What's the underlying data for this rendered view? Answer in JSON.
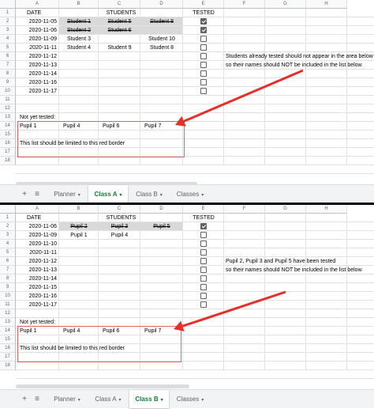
{
  "columns": [
    "A",
    "B",
    "C",
    "D",
    "E",
    "F",
    "G",
    "H"
  ],
  "rows": [
    "1",
    "2",
    "3",
    "4",
    "5",
    "6",
    "7",
    "8",
    "9",
    "10",
    "11",
    "12",
    "13",
    "14",
    "15",
    "16",
    "17",
    "18"
  ],
  "colors": {
    "tab_active": "#188038",
    "red_border": "#e06666",
    "arrow": "#e8302a",
    "cell_grey": "#d9d9d9"
  },
  "top": {
    "headers": {
      "date": "DATE",
      "students": "STUDENTS",
      "tested": "TESTED"
    },
    "records": [
      {
        "date": "2020-11-05",
        "b": "Student 1",
        "c": "Student 5",
        "d": "Student 8",
        "tested": true,
        "strike": true
      },
      {
        "date": "2020-11-06",
        "b": "Student 2",
        "c": "Student 6",
        "d": "",
        "tested": true,
        "strike": true
      },
      {
        "date": "2020-11-09",
        "b": "Student 3",
        "c": "",
        "d": "Student 10",
        "tested": false,
        "strike": false
      },
      {
        "date": "2020-11-11",
        "b": "Student 4",
        "c": "Student 9",
        "d": "Student 8",
        "tested": false,
        "strike": false
      },
      {
        "date": "2020-11-12",
        "b": "",
        "c": "",
        "d": "",
        "tested": false,
        "strike": false
      },
      {
        "date": "2020-11-13",
        "b": "",
        "c": "",
        "d": "",
        "tested": false,
        "strike": false
      },
      {
        "date": "2020-11-14",
        "b": "",
        "c": "",
        "d": "",
        "tested": false,
        "strike": false
      },
      {
        "date": "2020-11-16",
        "b": "",
        "c": "",
        "d": "",
        "tested": false,
        "strike": false
      },
      {
        "date": "2020-11-17",
        "b": "",
        "c": "",
        "d": "",
        "tested": false,
        "strike": false
      }
    ],
    "note1": "Students already tested should not appear in the area below",
    "note2": "so their names should NOT be included in the list below",
    "not_tested_label": "Not yet tested:",
    "pupils": [
      "Pupil 1",
      "Pupil 4",
      "Pupil 6",
      "Pupil 7"
    ],
    "limit_note": "This list should be limited to this red border",
    "tabs": [
      "Planner",
      "Class A",
      "Class B",
      "Classes"
    ],
    "active_tab": 1
  },
  "bottom": {
    "headers": {
      "date": "DATE",
      "students": "STUDENTS",
      "tested": "TESTED"
    },
    "records": [
      {
        "date": "2020-11-06",
        "b": "Pupil 2",
        "c": "Pupil 3",
        "d": "Pupil 5",
        "tested": true,
        "strike": true
      },
      {
        "date": "2020-11-09",
        "b": "Pupil 1",
        "c": "Pupil 4",
        "d": "",
        "tested": false,
        "strike": false
      },
      {
        "date": "2020-11-10",
        "b": "",
        "c": "",
        "d": "",
        "tested": false,
        "strike": false
      },
      {
        "date": "2020-11-11",
        "b": "",
        "c": "",
        "d": "",
        "tested": false,
        "strike": false
      },
      {
        "date": "2020-11-12",
        "b": "",
        "c": "",
        "d": "",
        "tested": false,
        "strike": false
      },
      {
        "date": "2020-11-13",
        "b": "",
        "c": "",
        "d": "",
        "tested": false,
        "strike": false
      },
      {
        "date": "2020-11-14",
        "b": "",
        "c": "",
        "d": "",
        "tested": false,
        "strike": false
      },
      {
        "date": "2020-11-15",
        "b": "",
        "c": "",
        "d": "",
        "tested": false,
        "strike": false
      },
      {
        "date": "2020-11-16",
        "b": "",
        "c": "",
        "d": "",
        "tested": false,
        "strike": false
      },
      {
        "date": "2020-11-17",
        "b": "",
        "c": "",
        "d": "",
        "tested": false,
        "strike": false
      }
    ],
    "note1": "Pupil 2, Pupil 3 and Pupil 5 have been tested",
    "note2": "so their names should NOT be included in the list below",
    "not_tested_label": "Not yet tested:",
    "pupils": [
      "Pupil 1",
      "Pupil 4",
      "Pupil 6",
      "Pupil 7"
    ],
    "limit_note": "This list should be limited to this red border",
    "tabs": [
      "Planner",
      "Class A",
      "Class B",
      "Classes"
    ],
    "active_tab": 2
  }
}
